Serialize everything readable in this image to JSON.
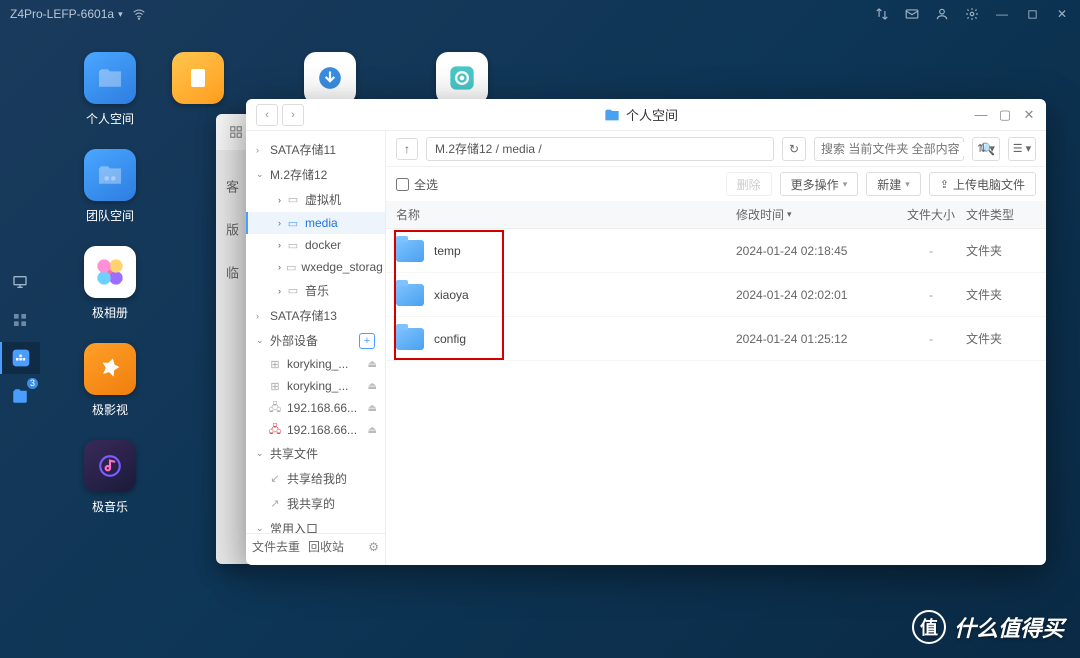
{
  "topbar": {
    "device_name": "Z4Pro-LEFP-6601a"
  },
  "desktop_icons": [
    {
      "label": "个人空间",
      "kind": "folder-blue"
    },
    {
      "label": "团队空间",
      "kind": "folder-blue"
    },
    {
      "label": "极相册",
      "kind": "flower"
    },
    {
      "label": "极影视",
      "kind": "orange"
    },
    {
      "label": "极音乐",
      "kind": "music"
    }
  ],
  "window": {
    "title": "个人空间",
    "path": "M.2存储12 / media /",
    "search_placeholder": "搜索 当前文件夹 全部内容",
    "select_all": "全选",
    "actions": {
      "delete": "删除",
      "more": "更多操作",
      "new": "新建",
      "upload": "上传电脑文件"
    },
    "columns": {
      "name": "名称",
      "time": "修改时间",
      "size": "文件大小",
      "type": "文件类型"
    },
    "rows": [
      {
        "name": "temp",
        "time": "2024-01-24 02:18:45",
        "size": "-",
        "type": "文件夹"
      },
      {
        "name": "xiaoya",
        "time": "2024-01-24 02:02:01",
        "size": "-",
        "type": "文件夹"
      },
      {
        "name": "config",
        "time": "2024-01-24 01:25:12",
        "size": "-",
        "type": "文件夹"
      }
    ]
  },
  "sidebar": {
    "groups": {
      "sata11": "SATA存储11",
      "m2_12": "M.2存储12",
      "sata13": "SATA存储13",
      "external": "外部设备",
      "share": "共享文件",
      "quick": "常用入口"
    },
    "m2_items": [
      {
        "label": "虚拟机"
      },
      {
        "label": "media",
        "selected": true
      },
      {
        "label": "docker"
      },
      {
        "label": "wxedge_storag"
      },
      {
        "label": "音乐"
      }
    ],
    "external_items": [
      {
        "label": "koryking_..."
      },
      {
        "label": "koryking_..."
      },
      {
        "label": "192.168.66..."
      },
      {
        "label": "192.168.66...",
        "warn": true
      }
    ],
    "share_items": [
      {
        "label": "共享给我的"
      },
      {
        "label": "我共享的"
      }
    ],
    "footer": {
      "dedupe": "文件去重",
      "recycle": "回收站"
    }
  },
  "dock_badge": "3",
  "watermark": "什么值得买"
}
